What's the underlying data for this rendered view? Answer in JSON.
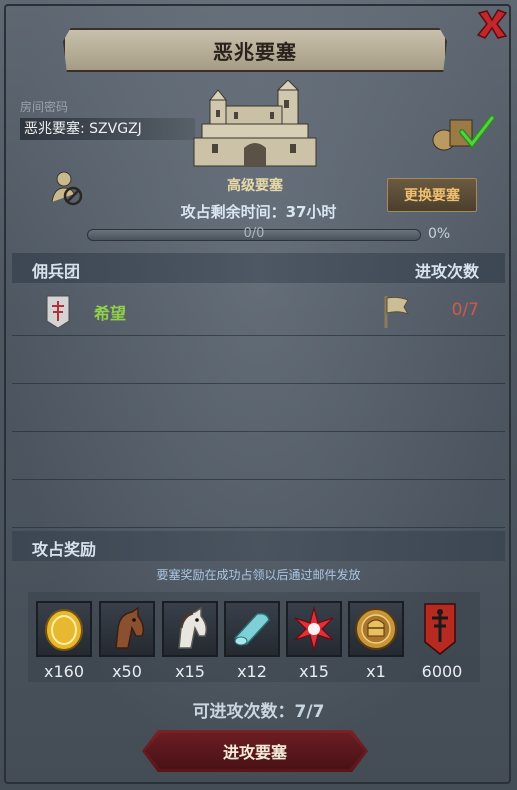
{
  "title": "恶兆要塞",
  "password": {
    "label": "房间密码",
    "value": "恶兆要塞: SZVGZJ"
  },
  "fortress": {
    "name": "高级要塞",
    "change_label": "更换要塞"
  },
  "remaining": {
    "text": "攻占剩余时间：37小时"
  },
  "progress": {
    "text": "0/0",
    "percent_text": "0%",
    "fraction": 0
  },
  "mercenary": {
    "header_left": "佣兵团",
    "header_right": "进攻次数",
    "rows": [
      {
        "name": "希望",
        "attacks": "0/7"
      }
    ]
  },
  "rewards": {
    "header": "攻占奖励",
    "note": "要塞奖励在成功占领以后通过邮件发放",
    "items": [
      {
        "icon": "gold-coin-icon",
        "qty": "x160"
      },
      {
        "icon": "brown-horse-icon",
        "qty": "x50"
      },
      {
        "icon": "white-horse-icon",
        "qty": "x15"
      },
      {
        "icon": "cloth-roll-icon",
        "qty": "x12"
      },
      {
        "icon": "red-crystal-icon",
        "qty": "x15"
      },
      {
        "icon": "knight-medal-icon",
        "qty": "x1"
      },
      {
        "icon": "red-banner-icon",
        "qty": "6000"
      }
    ]
  },
  "attempts": {
    "text": "可进攻次数：7/7"
  },
  "attack_button": {
    "label": "进攻要塞"
  },
  "colors": {
    "guild_name": "#8fd14a",
    "attacks": "#d05a4a",
    "change_button_text": "#f0c070",
    "close": "#c4262b"
  }
}
